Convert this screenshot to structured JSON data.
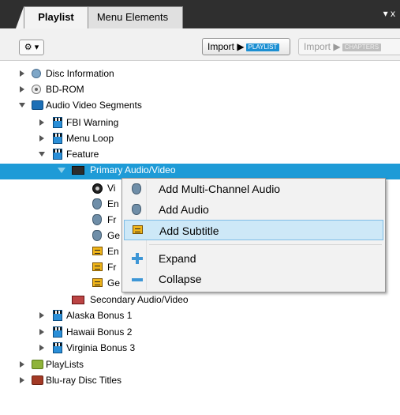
{
  "tabs": {
    "active": "Playlist",
    "inactive": "Menu Elements",
    "menu_glyph": "▾ x"
  },
  "toolbar": {
    "gear_icon": "gear-icon",
    "import_label": "Import ▶",
    "import_playlist_badge": "PLAYLIST",
    "import2_label": "Import ▶",
    "import_chapters_badge": "CHAPTERS"
  },
  "tree": {
    "disc_information": "Disc Information",
    "bd_rom": "BD-ROM",
    "audio_video_segments": "Audio Video Segments",
    "fbi_warning": "FBI Warning",
    "menu_loop": "Menu Loop",
    "feature": "Feature",
    "primary_av": "Primary Audio/Video",
    "child_vi": "Vi",
    "child_en1": "En",
    "child_fr1": "Fr",
    "child_ge1": "Ge",
    "child_en2": "En",
    "child_fr2": "Fr",
    "child_ge2": "Ge",
    "secondary_av": "Secondary Audio/Video",
    "alaska_bonus": "Alaska Bonus 1",
    "hawaii_bonus": "Hawaii Bonus 2",
    "virginia_bonus": "Virginia Bonus 3",
    "playlists": "PlayLists",
    "bluray_titles": "Blu-ray Disc Titles"
  },
  "context_menu": {
    "add_multichannel": "Add Multi-Channel Audio",
    "add_audio": "Add Audio",
    "add_subtitle": "Add Subtitle",
    "expand": "Expand",
    "collapse": "Collapse"
  },
  "colors": {
    "selection": "#1e9bd7",
    "menu_highlight": "#cde8f7",
    "tab_bar": "#2f2f2f"
  }
}
